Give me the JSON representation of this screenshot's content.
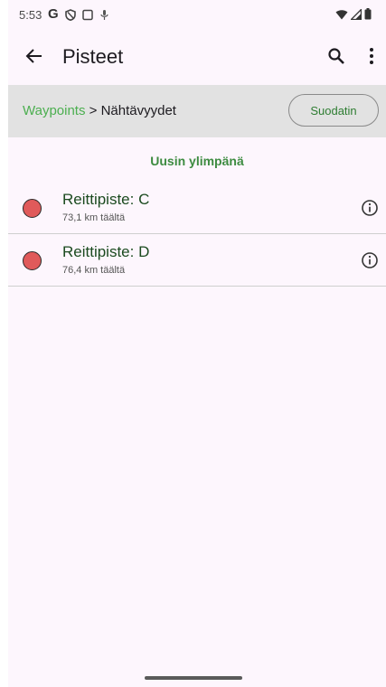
{
  "status_bar": {
    "time": "5:53",
    "google_letter": "G",
    "icons_left": [
      "google-icon",
      "vpn-shield-icon",
      "screenshot-icon",
      "mic-off-icon"
    ],
    "icons_right": [
      "wifi-icon",
      "signal-icon",
      "battery-icon"
    ]
  },
  "app_bar": {
    "title": "Pisteet",
    "icons": [
      "back-arrow-icon",
      "search-icon",
      "more-vert-icon"
    ]
  },
  "breadcrumb": {
    "link": "Waypoints",
    "separator": " > ",
    "current": "Nähtävyydet"
  },
  "filter_button": "Suodatin",
  "sort_label": "Uusin ylimpänä",
  "waypoints": [
    {
      "name": "Reittipiste: C",
      "distance": "73,1 km täältä"
    },
    {
      "name": "Reittipiste: D",
      "distance": "76,4 km täältä"
    }
  ],
  "colors": {
    "accent_green": "#4caf50",
    "marker_red": "#e05a5a",
    "background": "#fdf6fd",
    "breadcrumb_bg": "#e2e2e2"
  }
}
